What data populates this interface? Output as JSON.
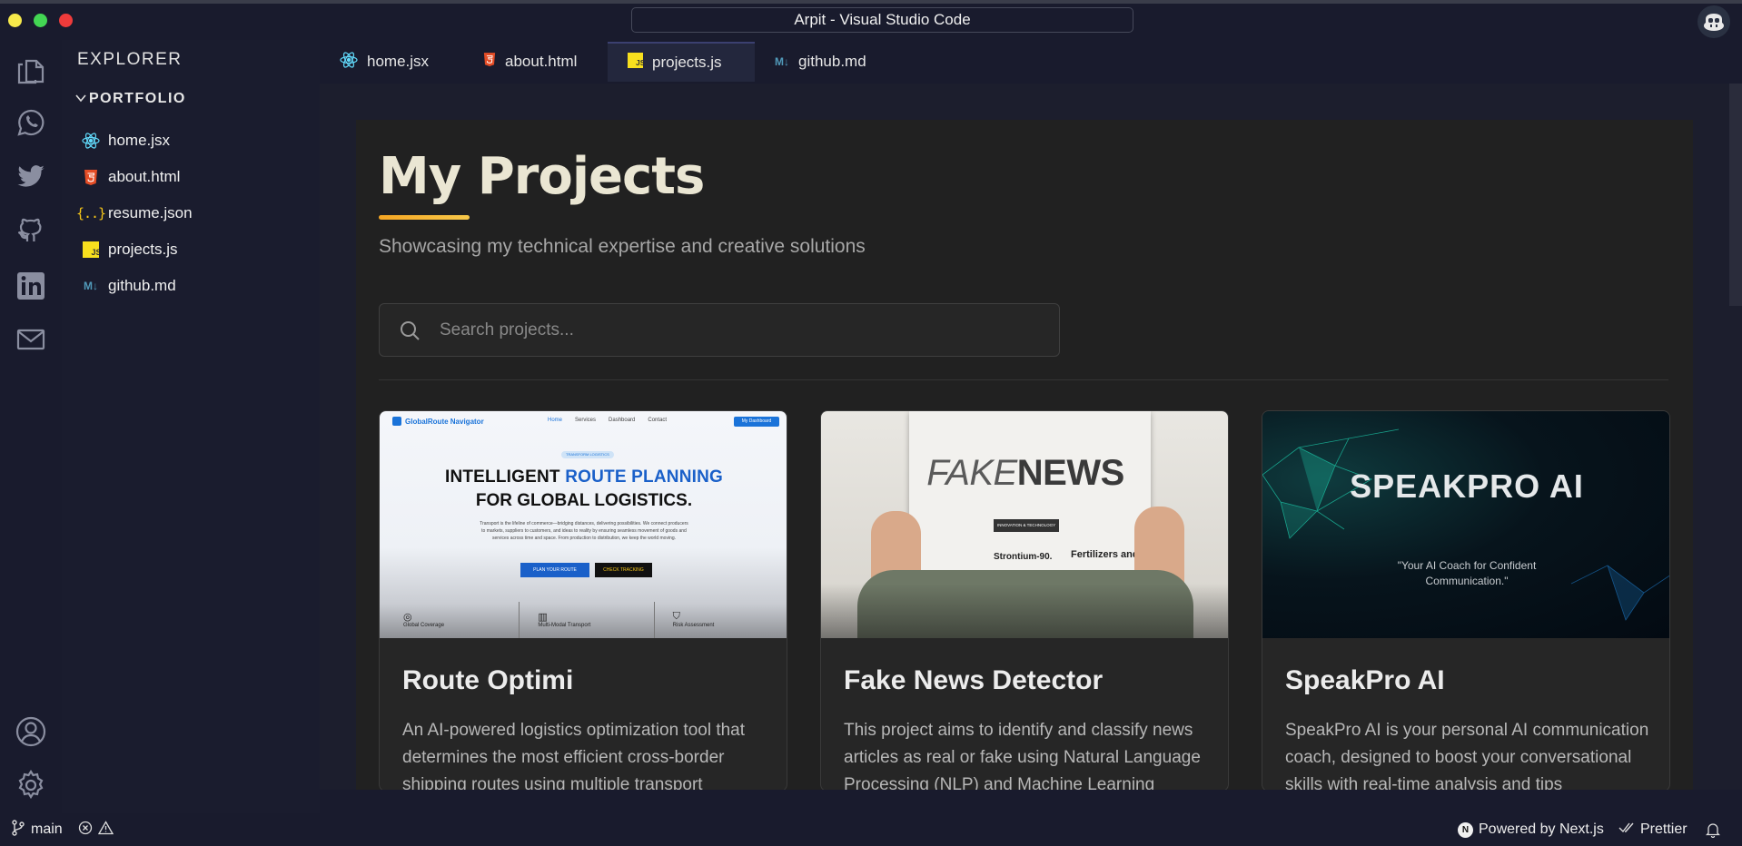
{
  "window": {
    "title": "Arpit - Visual Studio Code"
  },
  "activity_bar": {
    "icons": [
      "files-icon",
      "whatsapp-icon",
      "twitter-icon",
      "github-icon",
      "linkedin-icon",
      "mail-icon",
      "account-icon",
      "settings-icon"
    ]
  },
  "sidebar": {
    "title": "EXPLORER",
    "folder": "PORTFOLIO",
    "files": [
      {
        "name": "home.jsx",
        "icon": "react-icon"
      },
      {
        "name": "about.html",
        "icon": "html5-icon"
      },
      {
        "name": "resume.json",
        "icon": "json-icon"
      },
      {
        "name": "projects.js",
        "icon": "javascript-icon"
      },
      {
        "name": "github.md",
        "icon": "markdown-icon"
      }
    ]
  },
  "tabs": [
    {
      "label": "home.jsx",
      "icon": "react-icon",
      "active": false
    },
    {
      "label": "about.html",
      "icon": "html5-icon",
      "active": false
    },
    {
      "label": "projects.js",
      "icon": "javascript-icon",
      "active": true
    },
    {
      "label": "github.md",
      "icon": "markdown-icon",
      "active": false
    }
  ],
  "page": {
    "heading": "My Projects",
    "subtitle": "Showcasing my technical expertise and creative solutions",
    "search_placeholder": "Search projects...",
    "projects": [
      {
        "title": "Route Optimi",
        "description": "An AI-powered logistics optimization tool that determines the most efficient cross-border shipping routes using multiple transport",
        "thumb": {
          "brand": "GlobalRoute Navigator",
          "nav": [
            "Home",
            "Services",
            "Dashboard",
            "Contact"
          ],
          "cta": "My Dashboard",
          "pill": "TRANSFORM LOGISTICS",
          "headline_1a": "INTELLIGENT ",
          "headline_1b": "ROUTE PLANNING",
          "headline_2": "FOR GLOBAL LOGISTICS.",
          "body": "Transport is the lifeline of commerce—bridging distances, delivering possibilities. We connect producers to markets, suppliers to customers, and ideas to reality by ensuring seamless movement of goods and services across time and space. From production to distribution, we keep the world moving.",
          "btn_primary": "PLAN YOUR ROUTE",
          "btn_secondary": "CHECK TRACKING",
          "features": [
            "Global Coverage",
            "Multi-Modal Transport",
            "Risk Assessment"
          ]
        }
      },
      {
        "title": "Fake News Detector",
        "description": "This project aims to identify and classify news articles as real or fake using Natural Language Processing (NLP) and Machine Learning",
        "thumb": {
          "word_light": "FAKE",
          "word_bold": "NEWS",
          "tag": "INNOVATION & TECHNOLOGY",
          "col_left": "Strontium-90.",
          "col_right": "Fertilizers and"
        }
      },
      {
        "title": "SpeakPro AI",
        "description": "SpeakPro AI is your personal AI communication coach, designed to boost your conversational skills with real-time analysis and tips",
        "thumb": {
          "brand": "SPEAKPRO AI",
          "tagline": "\"Your AI Coach for Confident Communication.\""
        }
      }
    ]
  },
  "statusbar": {
    "branch": "main",
    "powered": "Powered by Next.js",
    "prettier": "Prettier"
  },
  "colors": {
    "accent": "#f5a623",
    "react": "#61dafb",
    "html": "#e44d26",
    "js": "#f7df1e",
    "markdown": "#519aba"
  }
}
